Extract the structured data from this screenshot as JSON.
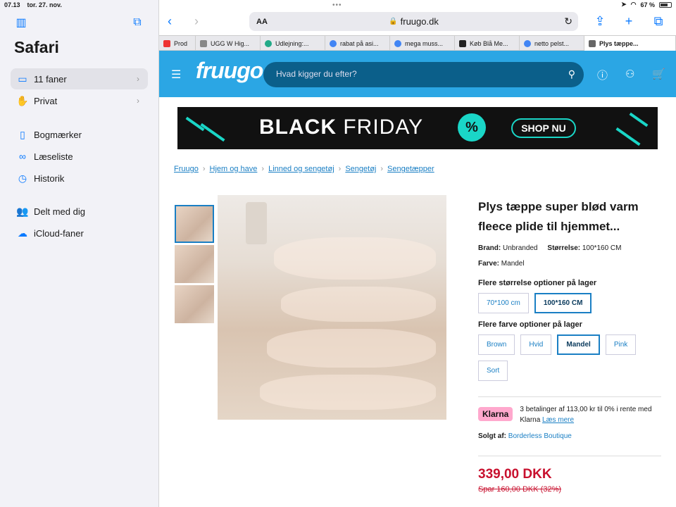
{
  "status_bar": {
    "time": "07.13",
    "date": "tor. 27. nov.",
    "dots": "•••",
    "battery_pct": "67 %"
  },
  "sidebar": {
    "title": "Safari",
    "items": [
      {
        "label": "11 faner",
        "icon": "tabs-icon",
        "chevron": "›"
      },
      {
        "label": "Privat",
        "icon": "hand-icon",
        "chevron": "›"
      },
      {
        "label": "Bogmærker",
        "icon": "book-icon"
      },
      {
        "label": "Læseliste",
        "icon": "glasses-icon"
      },
      {
        "label": "Historik",
        "icon": "clock-icon"
      },
      {
        "label": "Delt med dig",
        "icon": "people-icon"
      },
      {
        "label": "iCloud-faner",
        "icon": "cloud-icon"
      }
    ]
  },
  "toolbar": {
    "aa": "AA",
    "url": "fruugo.dk"
  },
  "tabs": [
    {
      "label": "Prod",
      "color": "#e33"
    },
    {
      "label": "UGG W Hig...",
      "color": "#888"
    },
    {
      "label": "Udlejning:...",
      "color": "#2a8"
    },
    {
      "label": "rabat på asi...",
      "color": "#4285f4"
    },
    {
      "label": "mega muss...",
      "color": "#4285f4"
    },
    {
      "label": "Køb Blå Me...",
      "color": "#222"
    },
    {
      "label": "netto pelst...",
      "color": "#4285f4"
    },
    {
      "label": "Plys tæppe...",
      "color": "#666"
    }
  ],
  "header": {
    "logo": "fruugo",
    "search_placeholder": "Hvad kigger du efter?"
  },
  "banner": {
    "black": "BLACK",
    "friday": "FRIDAY",
    "pct": "%",
    "cta": "SHOP NU"
  },
  "breadcrumb": [
    "Fruugo",
    "Hjem og have",
    "Linned og sengetøj",
    "Sengetøj",
    "Sengetæpper"
  ],
  "product": {
    "title": "Plys tæppe super blød varm fleece plide til hjemmet...",
    "brand_label": "Brand:",
    "brand": "Unbranded",
    "size_label": "Størrelse:",
    "size": "100*160 CM",
    "color_label": "Farve:",
    "color": "Mandel",
    "size_options_label": "Flere størrelse optioner på lager",
    "size_options": [
      "70*100 cm",
      "100*160 CM"
    ],
    "color_options_label": "Flere farve optioner på lager",
    "color_options": [
      "Brown",
      "Hvid",
      "Mandel",
      "Pink",
      "Sort"
    ],
    "klarna_badge": "Klarna",
    "klarna_text": "3 betalinger af 113,00 kr til 0% i rente med Klarna",
    "klarna_link": "Læs mere",
    "sold_by_label": "Solgt af:",
    "sold_by": "Borderless Boutique",
    "price": "339,00 DKK",
    "old_price": "Spar 160,00 DKK (32%)"
  }
}
